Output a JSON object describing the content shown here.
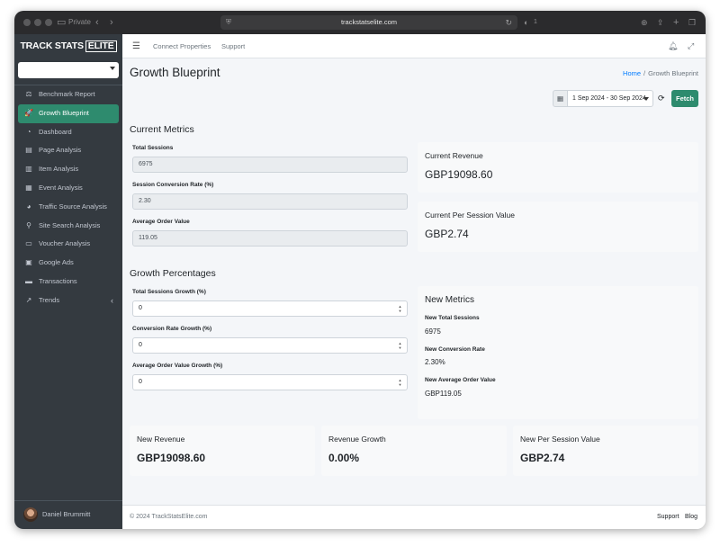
{
  "browser": {
    "private_label": "Private",
    "url": "trackstatselite.com",
    "extension_badge": "1",
    "icons": [
      "sidebar-icon",
      "back-icon",
      "forward-icon",
      "shield-icon",
      "reload-icon",
      "extension-icon",
      "download-icon",
      "share-icon",
      "new-tab-icon",
      "tabs-icon"
    ]
  },
  "brand": {
    "name": "TRACK STATS",
    "badge": "ELITE"
  },
  "sidebar": {
    "property_select": {
      "value": ""
    },
    "items": [
      {
        "label": "Benchmark Report",
        "icon": "balance-scale-icon",
        "glyph": "⚖"
      },
      {
        "label": "Growth Blueprint",
        "icon": "rocket-icon",
        "glyph": "🚀"
      },
      {
        "label": "Dashboard",
        "icon": "dashboard-icon",
        "glyph": "◔"
      },
      {
        "label": "Page Analysis",
        "icon": "file-icon",
        "glyph": "▤"
      },
      {
        "label": "Item Analysis",
        "icon": "chart-bar-icon",
        "glyph": "▥"
      },
      {
        "label": "Event Analysis",
        "icon": "calendar-icon",
        "glyph": "▦"
      },
      {
        "label": "Traffic Source Analysis",
        "icon": "pie-chart-icon",
        "glyph": "◕"
      },
      {
        "label": "Site Search Analysis",
        "icon": "search-icon",
        "glyph": "⚲"
      },
      {
        "label": "Voucher Analysis",
        "icon": "ticket-icon",
        "glyph": "▭"
      },
      {
        "label": "Google Ads",
        "icon": "ad-icon",
        "glyph": "▣"
      },
      {
        "label": "Transactions",
        "icon": "credit-card-icon",
        "glyph": "▬"
      },
      {
        "label": "Trends",
        "icon": "line-chart-icon",
        "glyph": "↗"
      }
    ],
    "user": {
      "name": "Daniel Brummitt"
    }
  },
  "topnav": {
    "links": [
      "Connect Properties",
      "Support"
    ],
    "icons": [
      "bars-icon",
      "bell-icon",
      "fullscreen-icon"
    ]
  },
  "page": {
    "title": "Growth Blueprint",
    "breadcrumb": {
      "home": "Home",
      "separator": "/",
      "current": "Growth Blueprint"
    },
    "date_range": "1 Sep 2024 - 30 Sep 2024",
    "fetch_label": "Fetch"
  },
  "current_metrics": {
    "title": "Current Metrics",
    "fields": [
      {
        "label": "Total Sessions",
        "value": "6975"
      },
      {
        "label": "Session Conversion Rate (%)",
        "value": "2.30"
      },
      {
        "label": "Average Order Value",
        "value": "119.05"
      }
    ],
    "revenue": {
      "label": "Current Revenue",
      "value": "GBP19098.60"
    },
    "per_session": {
      "label": "Current Per Session Value",
      "value": "GBP2.74"
    }
  },
  "growth_percentages": {
    "title": "Growth Percentages",
    "fields": [
      {
        "label": "Total Sessions Growth (%)",
        "value": "0"
      },
      {
        "label": "Conversion Rate Growth (%)",
        "value": "0"
      },
      {
        "label": "Average Order Value Growth (%)",
        "value": "0"
      }
    ]
  },
  "new_metrics": {
    "title": "New Metrics",
    "items": [
      {
        "label": "New Total Sessions",
        "value": "6975"
      },
      {
        "label": "New Conversion Rate",
        "value": "2.30%"
      },
      {
        "label": "New Average Order Value",
        "value": "GBP119.05"
      }
    ]
  },
  "summary": [
    {
      "label": "New Revenue",
      "value": "GBP19098.60"
    },
    {
      "label": "Revenue Growth",
      "value": "0.00%"
    },
    {
      "label": "New Per Session Value",
      "value": "GBP2.74"
    }
  ],
  "footer": {
    "copyright": "© 2024 TrackStatsElite.com",
    "links": [
      "Support",
      "Blog"
    ]
  }
}
